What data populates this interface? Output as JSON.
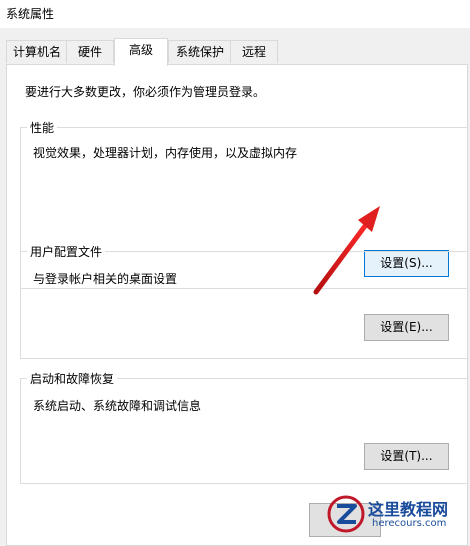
{
  "window": {
    "title": "系统属性"
  },
  "tabs": [
    {
      "label": "计算机名"
    },
    {
      "label": "硬件"
    },
    {
      "label": "高级"
    },
    {
      "label": "系统保护"
    },
    {
      "label": "远程"
    }
  ],
  "admin_notice": "要进行大多数更改，你必须作为管理员登录。",
  "performance": {
    "title": "性能",
    "description": "视觉效果，处理器计划，内存使用，以及虚拟内存",
    "button": "设置(S)..."
  },
  "user_profiles": {
    "title": "用户配置文件",
    "description": "与登录帐户相关的桌面设置",
    "button": "设置(E)..."
  },
  "startup_recovery": {
    "title": "启动和故障恢复",
    "description": "系统启动、系统故障和调试信息",
    "button": "设置(T)..."
  },
  "watermark": {
    "name": "这里教程网",
    "url": "herecours.com"
  },
  "colors": {
    "arrow": "#e02020",
    "accent": "#0078d7"
  }
}
